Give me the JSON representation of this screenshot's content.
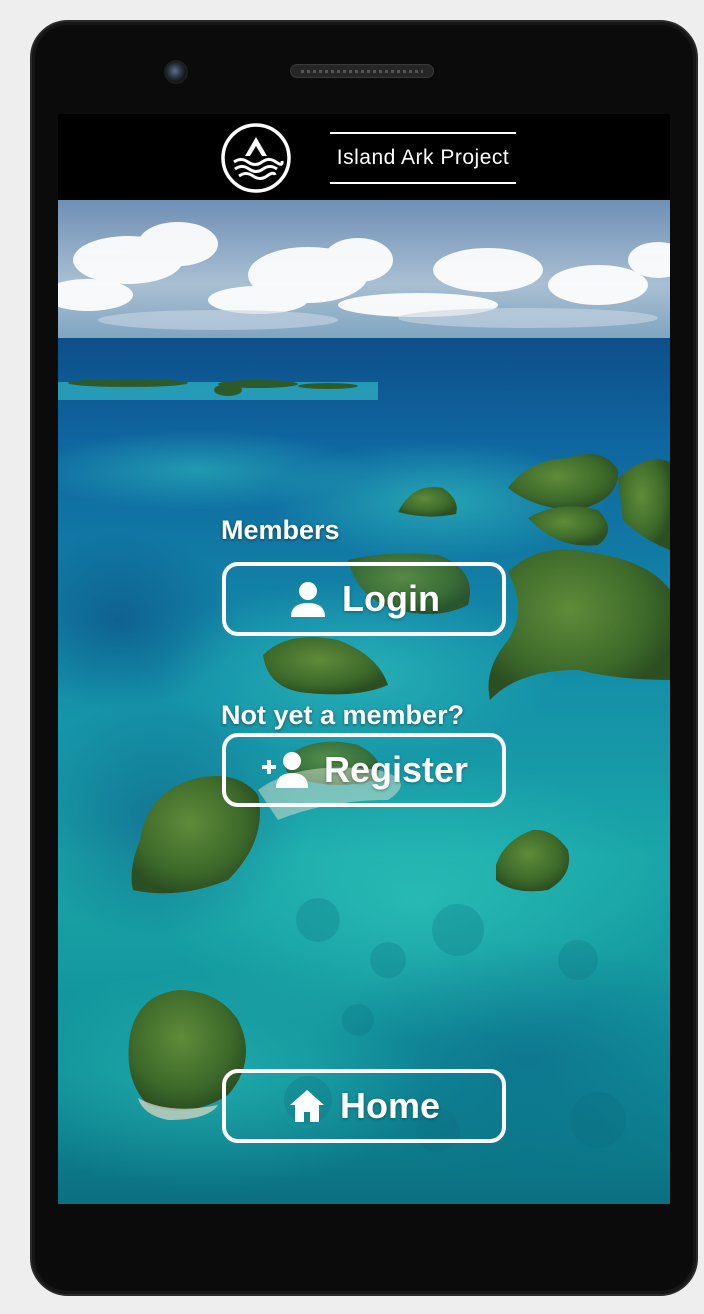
{
  "header": {
    "brand_name": "Island Ark Project",
    "logo_icon": "island-wave-logo-icon"
  },
  "members": {
    "heading": "Members",
    "login_label": "Login",
    "login_icon": "user-icon"
  },
  "register": {
    "heading": "Not yet a member?",
    "register_label": "Register",
    "register_icon": "user-plus-icon"
  },
  "home": {
    "home_label": "Home",
    "home_icon": "home-icon"
  },
  "colors": {
    "button_border": "#ffffff",
    "text": "#ffffff",
    "header_bg": "#000000",
    "device_body": "#0b0b0b"
  }
}
